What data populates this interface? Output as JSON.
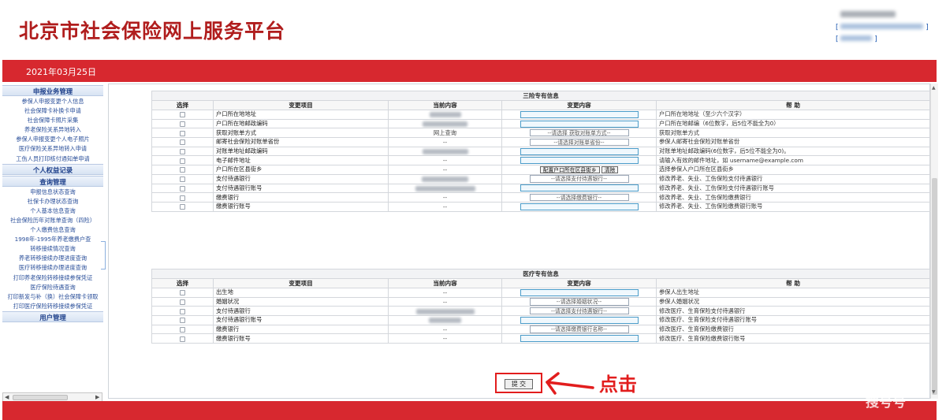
{
  "page": {
    "title": "北京市社会保险网上服务平台",
    "date": "2021年03月25日",
    "watermark": "搜号号"
  },
  "sidebar": {
    "groups": [
      {
        "title": "申报业务管理",
        "items": [
          "参保人申报变更个人信息",
          "社会保障卡补换卡申请",
          "社会保障卡照片采集",
          "养老保险关系异地转入",
          "参保人申报变更个人电子照片",
          "医疗保险关系异地转入申请",
          "工伤人员打印核付通知单申请"
        ]
      },
      {
        "title": "个人权益记录",
        "items": []
      },
      {
        "title": "查询管理",
        "items": [
          "申报信息状态查询",
          "社保卡办理状态查询",
          "个人基本信息查询",
          "社会保险历年对账单查询（四险）",
          "个人缴费信息查询",
          "1998年-1995年养老缴费户查",
          "转移接续情况查询",
          "养老转移接续办理进度查询",
          "医疗转移接续办理进度查询",
          "打印养老保险转移接续参保凭证",
          "医疗保险待遇查询",
          "打印新发与补（换）社会保障卡领取",
          "打印医疗保险转移接续参保凭证"
        ]
      },
      {
        "title": "用户管理",
        "items": []
      }
    ]
  },
  "section_sanxian": {
    "title": "三险专有信息",
    "headers": [
      "选择",
      "变更项目",
      "当前内容",
      "变更内容",
      "帮  助"
    ],
    "rows": [
      {
        "item": "户口所在地地址",
        "current": "",
        "input": "text",
        "help": "户口所在地地址（至少六个汉字）"
      },
      {
        "item": "户口所在地邮政编码",
        "current": "",
        "input": "text",
        "help": "户口所在地邮编（6位数字，后5位不能全为0）"
      },
      {
        "item": "获取对账单方式",
        "current": "网上查询",
        "input": "select",
        "select_label": "--请选择 获取对账单方式--",
        "help": "获取对账单方式"
      },
      {
        "item": "邮寄社会保险对账单省份",
        "current": "--",
        "input": "select",
        "select_label": "--请选择对账单省份--",
        "help": "参保人邮寄社会保险对账单省份"
      },
      {
        "item": "对账单地址邮政编码",
        "current": "",
        "input": "text",
        "help": "对账单地址邮政编码(6位数字，后5位不能全为0)。"
      },
      {
        "item": "电子邮件地址",
        "current": "--",
        "input": "text",
        "help": "请输入有效的邮件地址，如 username@example.com"
      },
      {
        "item": "户口所在区县街乡",
        "current": "--",
        "input": "buttons",
        "buttons": [
          "配置户口所在区县街乡",
          "清除"
        ],
        "help": "选择参保人户口所在区县街乡"
      },
      {
        "item": "支付待遇银行",
        "current": "",
        "input": "select",
        "select_label": "--请选择支付待遇银行--",
        "help": "修改养老、失业、工伤保险支付待遇银行"
      },
      {
        "item": "支付待遇银行账号",
        "current": "",
        "input": "text",
        "help": "修改养老、失业、工伤保险支付待遇银行账号"
      },
      {
        "item": "缴费银行",
        "current": "--",
        "input": "select",
        "select_label": "--请选择缴费银行--",
        "help": "修改养老、失业、工伤保险缴费银行"
      },
      {
        "item": "缴费银行账号",
        "current": "--",
        "input": "text",
        "help": "修改养老、失业、工伤保险缴费银行账号"
      }
    ]
  },
  "section_yiliao": {
    "title": "医疗专有信息",
    "headers": [
      "选择",
      "变更项目",
      "当前内容",
      "变更内容",
      "帮  助"
    ],
    "rows": [
      {
        "item": "出生地",
        "current": "--",
        "input": "text",
        "help": "参保人出生地址"
      },
      {
        "item": "婚姻状况",
        "current": "--",
        "input": "select",
        "select_label": "--请选择婚姻状况--",
        "help": "参保人婚姻状况"
      },
      {
        "item": "支付待遇银行",
        "current": "",
        "input": "select",
        "select_label": "--请选择支付待遇银行--",
        "help": "修改医疗、生育保险支付待遇银行"
      },
      {
        "item": "支付待遇银行账号",
        "current": "",
        "input": "text",
        "help": "修改医疗、生育保险支付待遇银行账号"
      },
      {
        "item": "缴费银行",
        "current": "--",
        "input": "select",
        "select_label": "--请选择缴费银行名称--",
        "help": "修改医疗、生育保险缴费银行"
      },
      {
        "item": "缴费银行账号",
        "current": "--",
        "input": "text",
        "help": "修改医疗、生育保险缴费银行账号"
      }
    ]
  },
  "submit_label": "提 交",
  "annotation": {
    "label": "点击",
    "color": "#e21d1d"
  },
  "colors": {
    "brand_red": "#d7282f",
    "title_red": "#b01d1d",
    "link_blue": "#2a4f9a",
    "input_border": "#4a9bc8"
  }
}
